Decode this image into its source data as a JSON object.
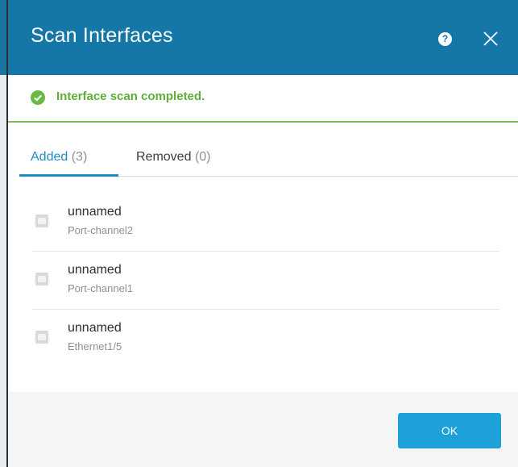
{
  "dialog": {
    "title": "Scan Interfaces",
    "help_glyph": "?",
    "close_icon": "close-icon"
  },
  "status": {
    "message": "Interface scan completed.",
    "icon": "check-circle-icon",
    "color": "#5fae3a"
  },
  "tabs": [
    {
      "label": "Added",
      "count": "(3)",
      "active": true
    },
    {
      "label": "Removed",
      "count": "(0)",
      "active": false
    }
  ],
  "interfaces": [
    {
      "name": "unnamed",
      "port": "Port-channel2",
      "icon": "interface-icon"
    },
    {
      "name": "unnamed",
      "port": "Port-channel1",
      "icon": "interface-icon"
    },
    {
      "name": "unnamed",
      "port": "Ethernet1/5",
      "icon": "interface-icon"
    }
  ],
  "footer": {
    "ok_label": "OK"
  },
  "colors": {
    "header": "#1477a7",
    "accent": "#1e8fc6",
    "button": "#1ea0d8",
    "success": "#7cbd57"
  }
}
